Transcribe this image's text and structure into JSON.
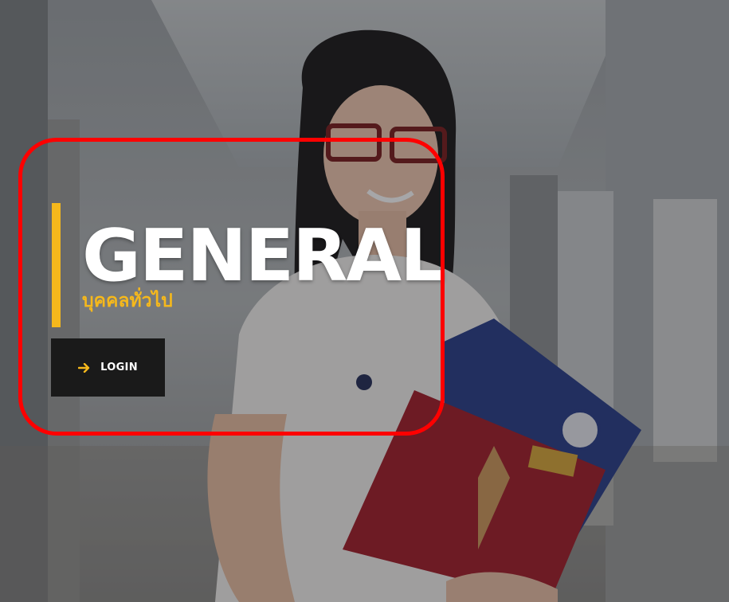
{
  "hero": {
    "title": "GENERAL",
    "subtitle": "บุคคลทั่วไป",
    "login_label": "LOGIN",
    "login_icon": "arrow-right-icon",
    "background_photo": "student-with-books-photo"
  },
  "colors": {
    "accent": "#f5b81c",
    "button_bg": "#1a1a1a",
    "highlight": "#ff0000"
  }
}
